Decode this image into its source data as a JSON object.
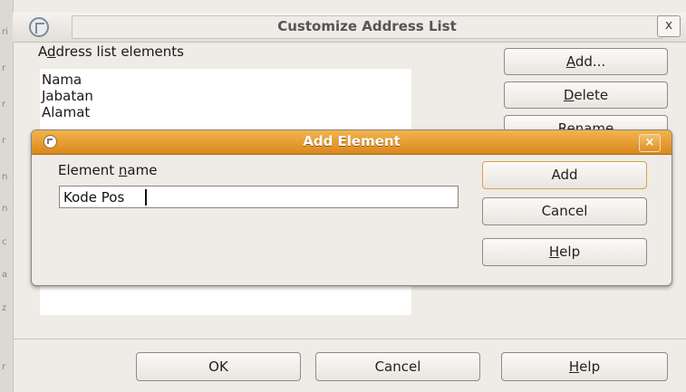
{
  "outer_dialog": {
    "title": "Customize Address List",
    "close_label": "x",
    "list_label_prefix": "A",
    "list_label_mnemonic": "d",
    "list_label_rest": "dress list elements",
    "list_items": [
      "Nama",
      "Jabatan",
      "Alamat"
    ],
    "buttons": {
      "add_mnemonic": "A",
      "add_rest": "dd...",
      "delete_mnemonic": "D",
      "delete_rest": "elete",
      "rename": "Rename"
    },
    "footer": {
      "ok": "OK",
      "cancel": "Cancel",
      "help_mnemonic": "H",
      "help_rest": "elp"
    }
  },
  "inner_dialog": {
    "title": "Add Element",
    "close_label": "×",
    "field_label_prefix": "Element ",
    "field_label_mnemonic": "n",
    "field_label_rest": "ame",
    "field_value": "Kode Pos",
    "buttons": {
      "add": "Add",
      "cancel": "Cancel",
      "help_mnemonic": "H",
      "help_rest": "elp"
    }
  },
  "icons": {
    "outer_app_icon": "app-icon",
    "inner_app_icon": "app-icon",
    "close": "close-icon"
  },
  "colors": {
    "titlebar_accent": "#e09a2c",
    "window_bg": "#efebe7"
  }
}
